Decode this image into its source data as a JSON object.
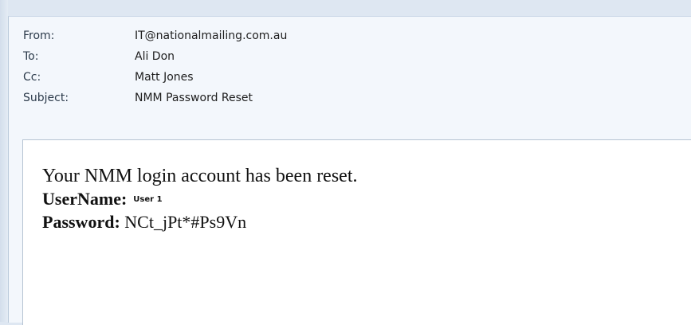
{
  "header": {
    "from_label": "From:",
    "from_value": "IT@nationalmailing.com.au",
    "to_label": "To:",
    "to_value": "Ali Don",
    "cc_label": "Cc:",
    "cc_value": "Matt Jones",
    "subject_label": "Subject:",
    "subject_value": "NMM Password Reset"
  },
  "message": {
    "line1": "Your NMM login account has been reset.",
    "username_label": "UserName:",
    "username_value": "User 1",
    "password_label": "Password:",
    "password_value": "NCt_jPt*#Ps9Vn"
  }
}
